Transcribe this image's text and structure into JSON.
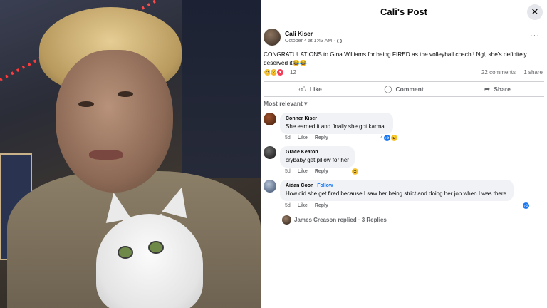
{
  "photo": {
    "description_icon": "profile-photo-with-white-cat"
  },
  "header": {
    "title": "Cali's Post",
    "close_icon": "close-icon"
  },
  "post": {
    "author": "Cali Kiser",
    "timestamp": "October 4 at 1:43 AM",
    "separator": "·",
    "audience_icon": "globe-icon",
    "more_label": "···",
    "text": "CONGRATULATIONS to Gina Williams for being FIRED as the volleyball coach!! Ngl, she's definitely deserved it😂😂",
    "reaction_count": "12",
    "comments_count": "22 comments",
    "shares_count": "1 share"
  },
  "actions": {
    "like": "Like",
    "comment": "Comment",
    "share": "Share"
  },
  "sort_label": "Most relevant",
  "comments": [
    {
      "name": "Conner Kiser",
      "text": "She earned it and finally she got karma .",
      "time": "5d",
      "like": "Like",
      "reply": "Reply",
      "reaction_count": "4"
    },
    {
      "name": "Grace Keaton",
      "text": "crybaby get pillow for her",
      "time": "5d",
      "like": "Like",
      "reply": "Reply"
    },
    {
      "name": "Aidan Coon",
      "follow": "Follow",
      "text": "How did she get fired because I saw her being strict and doing her job when I was there.",
      "time": "5d",
      "like": "Like",
      "reply": "Reply"
    }
  ],
  "replies_label": "James Creason replied · 3 Replies",
  "colors": {
    "accent": "#1877f2",
    "muted": "#65676b",
    "bubble": "#f0f2f5"
  }
}
